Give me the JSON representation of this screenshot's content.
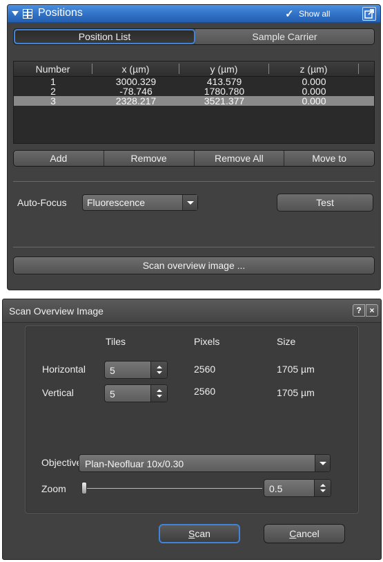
{
  "positions": {
    "title": "Positions",
    "show_all": "Show all",
    "tabs": [
      "Position List",
      "Sample Carrier"
    ],
    "active_tab": "Position List",
    "columns": [
      "Number",
      "x (µm)",
      "y (µm)",
      "z (µm)"
    ],
    "rows": [
      {
        "number": "1",
        "x": "3000.329",
        "y": "413.579",
        "z": "0.000"
      },
      {
        "number": "2",
        "x": "-78.746",
        "y": "1780.780",
        "z": "0.000"
      },
      {
        "number": "3",
        "x": "2328.217",
        "y": "3521.377",
        "z": "0.000"
      }
    ],
    "selected_row": 3,
    "buttons": [
      "Add",
      "Remove",
      "Remove All",
      "Move to"
    ],
    "autofocus_label": "Auto-Focus",
    "autofocus_value": "Fluorescence",
    "test_label": "Test",
    "scan_overview_label": "Scan overview image ..."
  },
  "dialog": {
    "title": "Scan Overview Image",
    "help": "?",
    "close": "×",
    "headers": {
      "tiles": "Tiles",
      "pixels": "Pixels",
      "size": "Size"
    },
    "horizontal": {
      "label": "Horizontal",
      "tiles": "5",
      "pixels": "2560",
      "size": "1705 µm"
    },
    "vertical": {
      "label": "Vertical",
      "tiles": "5",
      "pixels": "2560",
      "size": "1705 µm"
    },
    "objective_label": "Objective",
    "objective_value": "Plan-Neofluar 10x/0.30",
    "zoom_label": "Zoom",
    "zoom_value": "0.5",
    "zoom_level": 0.0,
    "scan_label_first": "S",
    "scan_label_rest": "can",
    "cancel_label_first": "C",
    "cancel_label_rest": "ancel"
  },
  "colors": {
    "accent": "#3f84d8",
    "panel_bg": "#414141",
    "header_blue": "#2f6fc4"
  }
}
